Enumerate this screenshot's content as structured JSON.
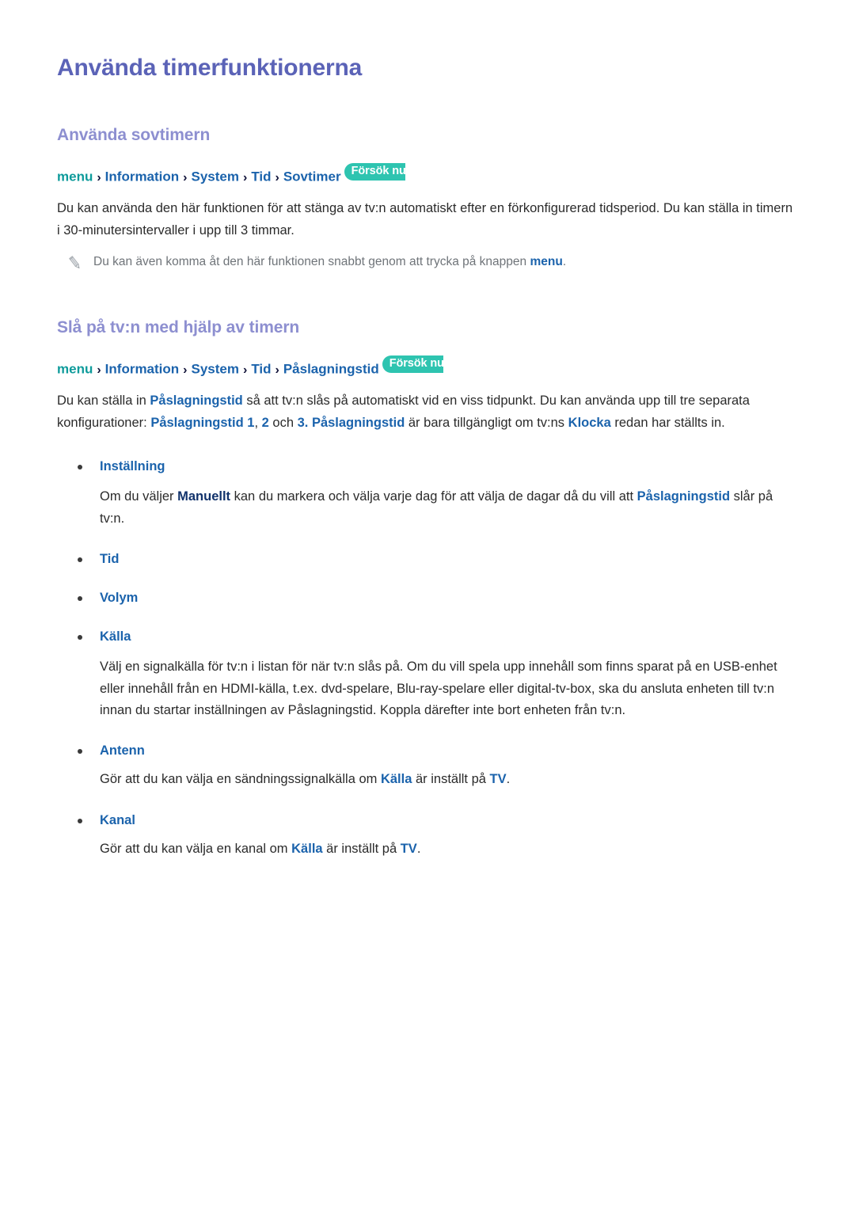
{
  "document": {
    "title": "Använda timerfunktionerna"
  },
  "sections": [
    {
      "heading": "Använda sovtimern",
      "breadcrumb": {
        "root": "menu",
        "separator": "›",
        "items": [
          "Information",
          "System",
          "Tid",
          "Sovtimer"
        ],
        "badge": "Försök nu"
      },
      "paragraph": {
        "part1": "Du kan använda den här funktionen för att stänga av tv:n automatiskt efter en förkonfigurerad tidsperiod. Du kan ställa in timern i 30-minutersintervaller i upp till 3 timmar."
      },
      "note": {
        "icon": "pencil-icon",
        "text_before": "Du kan även komma åt den här funktionen snabbt genom att trycka på knappen ",
        "highlight": "menu",
        "text_after": "."
      }
    },
    {
      "heading": "Slå på tv:n med hjälp av timern",
      "breadcrumb": {
        "root": "menu",
        "separator": "›",
        "items": [
          "Information",
          "System",
          "Tid",
          "Påslagningstid"
        ],
        "badge": "Försök nu"
      },
      "paragraph": {
        "p1": "Du kan ställa in ",
        "p1_hl": "Påslagningstid",
        "p2": " så att tv:n slås på automatiskt vid en viss tidpunkt. Du kan använda upp till tre separata konfigurationer: ",
        "p2_hl": "Påslagningstid 1",
        "p3": ", ",
        "p3_hl": "2",
        "p4": " och ",
        "p4_hl": "3. Påslagningstid",
        "p5": " är bara tillgängligt om tv:ns ",
        "p5_hl": "Klocka",
        "p6": " redan har ställts in."
      },
      "bullets": [
        {
          "label": "Inställning",
          "body": {
            "b1": "Om du väljer ",
            "b1_hl": "Manuellt",
            "b2": " kan du markera och välja varje dag för att välja de dagar då du vill att ",
            "b2_hl": "Påslagningstid",
            "b3": " slår på tv:n."
          }
        },
        {
          "label": "Tid",
          "body": null
        },
        {
          "label": "Volym",
          "body": null
        },
        {
          "label": "Källa",
          "body": {
            "plain": "Välj en signalkälla för tv:n i listan för när tv:n slås på. Om du vill spela upp innehåll som finns sparat på en USB-enhet eller innehåll från en HDMI-källa, t.ex. dvd-spelare, Blu-ray-spelare eller digital-tv-box, ska du ansluta enheten till tv:n innan du startar inställningen av Påslagningstid. Koppla därefter inte bort enheten från tv:n."
          }
        },
        {
          "label": "Antenn",
          "body": {
            "a1": "Gör att du kan välja en sändningssignalkälla om ",
            "a1_hl": "Källa",
            "a2": " är inställt på ",
            "a2_hl": "TV",
            "a3": "."
          }
        },
        {
          "label": "Kanal",
          "body": {
            "k1": "Gör att du kan välja en kanal om ",
            "k1_hl": "Källa",
            "k2": " är inställt på ",
            "k2_hl": "TV",
            "k3": "."
          }
        }
      ]
    }
  ],
  "colors": {
    "title": "#5b63b7",
    "section_heading": "#8d8fd0",
    "breadcrumb_root": "#0e9b9b",
    "breadcrumb_item": "#1b63ac",
    "badge_background": "#2ec4b0",
    "highlight": "#1b63ac",
    "body_text": "#2b2b2b",
    "note_text": "#6f7479"
  }
}
